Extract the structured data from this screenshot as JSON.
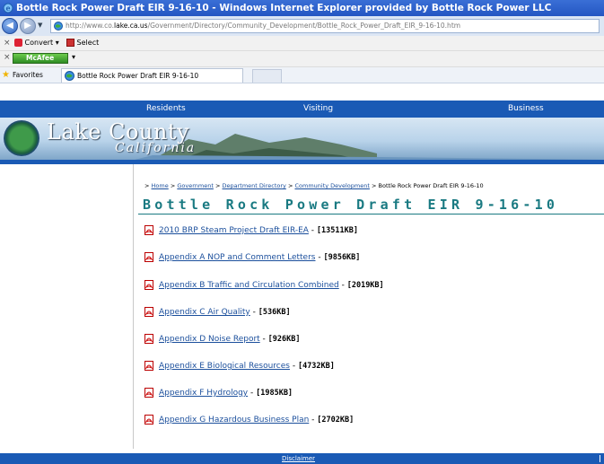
{
  "window": {
    "title": "Bottle Rock Power Draft EIR 9-16-10 - Windows Internet Explorer provided by Bottle Rock Power LLC"
  },
  "address": {
    "prefix": "http://www.co.",
    "host": "lake.ca.us",
    "path": "/Government/Directory/Community_Development/Bottle_Rock_Power_Draft_EIR_9-16-10.htm"
  },
  "toolbar": {
    "convert_label": "Convert",
    "select_label": "Select",
    "mcafee_label": "McAfee"
  },
  "tabbar": {
    "favorites_label": "Favorites",
    "tab_title": "Bottle Rock Power Draft EIR 9-16-10"
  },
  "sitenav": {
    "items": [
      "Residents",
      "Visiting",
      "Business"
    ]
  },
  "banner": {
    "brand_line1": "Lake County",
    "brand_line2": "California"
  },
  "breadcrumb": {
    "sep": ">",
    "home": "Home",
    "government": "Government",
    "directory": "Department Directory",
    "community": "Community Development",
    "current": "Bottle Rock Power Draft EIR 9-16-10"
  },
  "page": {
    "title": "Bottle Rock Power Draft EIR 9-16-10"
  },
  "documents": [
    {
      "label": "2010 BRP Steam Project Draft EIR-EA",
      "size": "[13511KB]"
    },
    {
      "label": "Appendix A  NOP and Comment Letters",
      "size": "[9856KB]"
    },
    {
      "label": "Appendix B  Traffic and Circulation Combined",
      "size": "[2019KB]"
    },
    {
      "label": "Appendix C  Air Quality",
      "size": "[536KB]"
    },
    {
      "label": "Appendix D  Noise Report",
      "size": "[926KB]"
    },
    {
      "label": "Appendix E  Biological Resources",
      "size": "[4732KB]"
    },
    {
      "label": "Appendix F  Hydrology",
      "size": "[1985KB]"
    },
    {
      "label": "Appendix G  Hazardous Business Plan",
      "size": "[2702KB]"
    }
  ],
  "doc_separator": " - ",
  "footer": {
    "disclaimer": "Disclaimer"
  },
  "icons": {
    "pdf": "pdf-icon",
    "ie": "ie-icon",
    "globe": "globe-icon",
    "favorites": "star-icon"
  },
  "colors": {
    "nav_blue": "#1a5ab5",
    "title_teal": "#1a7a82",
    "link_blue": "#1b4f9c"
  }
}
